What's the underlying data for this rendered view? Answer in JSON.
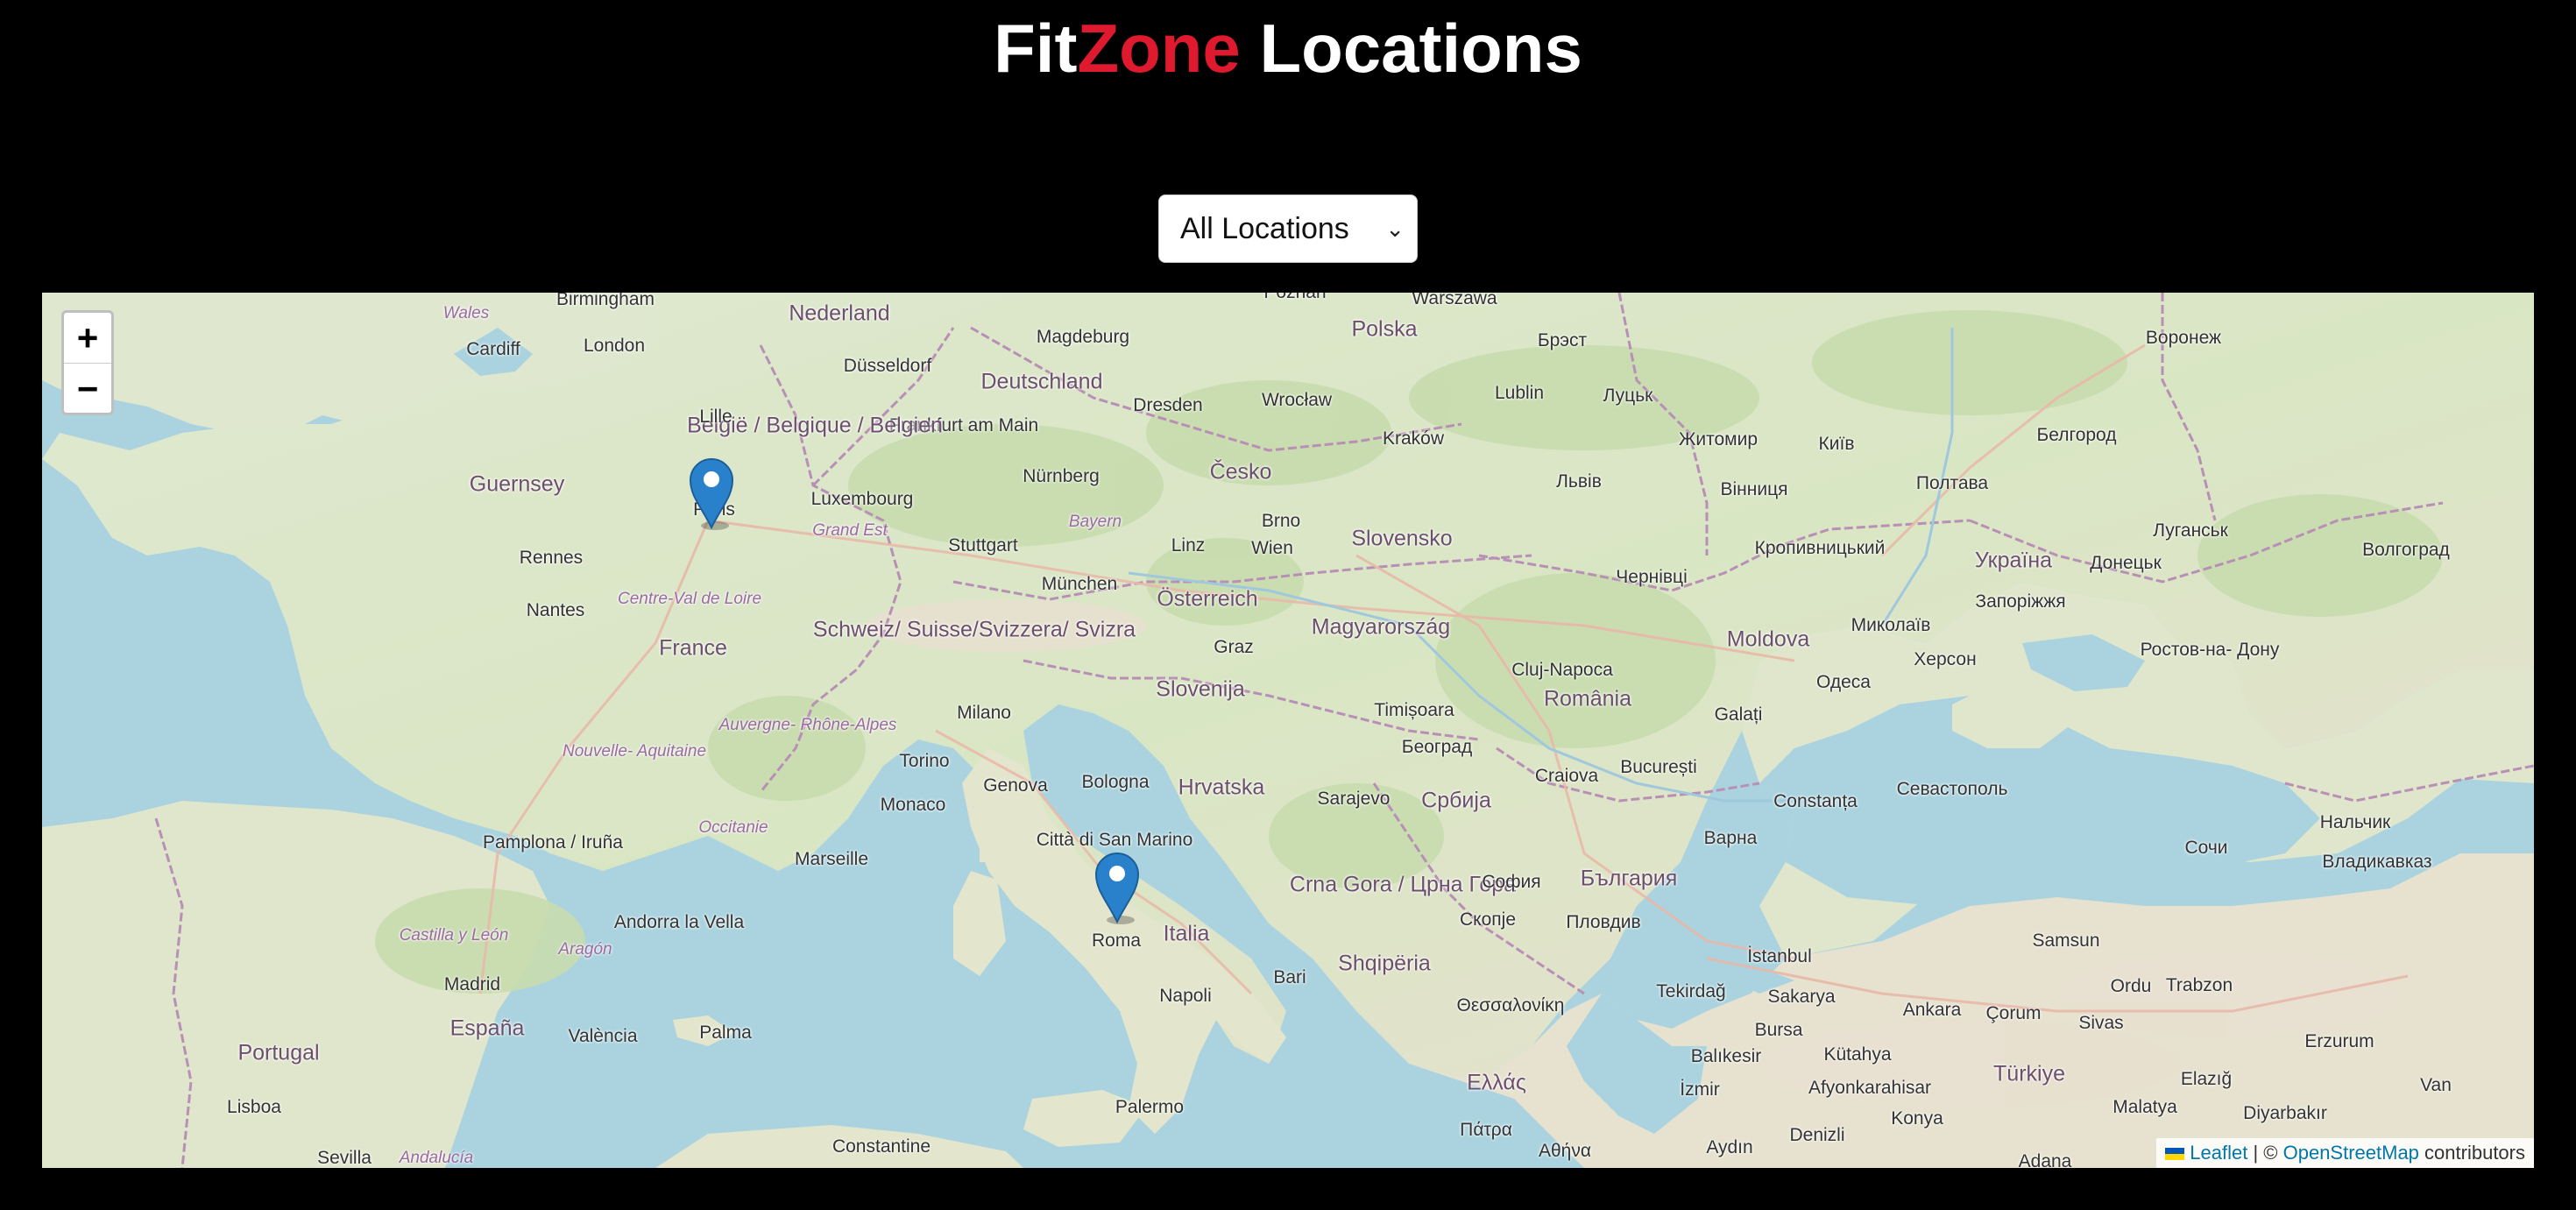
{
  "header": {
    "title_part1": "Fit",
    "title_accent": "Zone",
    "title_part2": " Locations",
    "accent_color": "#e01a2e"
  },
  "filter": {
    "selected": "All Locations",
    "chevron_icon": "chevron-down-icon"
  },
  "map": {
    "zoom_in_label": "+",
    "zoom_out_label": "−",
    "markers": [
      {
        "city": "Paris",
        "icon": "map-pin-icon"
      },
      {
        "city": "Roma",
        "icon": "map-pin-icon"
      }
    ],
    "attribution": {
      "leaflet": "Leaflet",
      "separator": "| ©",
      "osm": "OpenStreetMap",
      "suffix": "contributors"
    },
    "labels": {
      "birmingham": "Birmingham",
      "wales": "Wales",
      "cardiff": "Cardiff",
      "london": "London",
      "nederland": "Nederland",
      "dusseldorf": "Düsseldorf",
      "magdeburg": "Magdeburg",
      "deutschland": "Deutschland",
      "polska": "Polska",
      "warszawa": "Warszawa",
      "dresden": "Dresden",
      "wroclaw": "Wrocław",
      "lublin": "Lublin",
      "frankfurt": "Frankfurt am Main",
      "belgie": "België / Belgique / Belgien",
      "lille": "Lille",
      "guernsey": "Guernsey",
      "luxembourg": "Luxembourg",
      "nurnberg": "Nürnberg",
      "cesko": "Česko",
      "krakow": "Kraków",
      "brno": "Brno",
      "paris": "Paris",
      "rennes": "Rennes",
      "grand_est": "Grand Est",
      "stuttgart": "Stuttgart",
      "bayern": "Bayern",
      "linz": "Linz",
      "wien": "Wien",
      "slovensko": "Slovensko",
      "centre": "Centre-Val de Loire",
      "munchen": "München",
      "osterreich": "Österreich",
      "nantes": "Nantes",
      "schweiz": "Schweiz/ Suisse/Svizzera/ Svizra",
      "magyarorszag": "Magyarország",
      "france": "France",
      "graz": "Graz",
      "slovenija": "Slovenija",
      "cluj": "Cluj-Napoca",
      "romania": "România",
      "auvergne": "Auvergne- Rhône-Alpes",
      "nouvelle": "Nouvelle- Aquitaine",
      "milano": "Milano",
      "timisoara": "Timișoara",
      "torino": "Torino",
      "bologna": "Bologna",
      "hrvatska": "Hrvatska",
      "beograd": "Београд",
      "craiova": "Craiova",
      "bucuresti": "București",
      "galati": "Galați",
      "moldova": "Moldova",
      "odesa": "Одеса",
      "occitanie": "Occitanie",
      "monaco": "Monaco",
      "genova": "Genova",
      "sarajevo": "Sarajevo",
      "srbija": "Србија",
      "constanta": "Constanța",
      "pamplona": "Pamplona / Iruña",
      "marseille": "Marseille",
      "citta": "Città di San Marino",
      "crna_gora": "Crna Gora / Црна Гора",
      "sofia": "София",
      "bulgaria": "България",
      "varna": "Варна",
      "andorra": "Andorra la Vella",
      "castilla": "Castilla y León",
      "aragon": "Aragón",
      "roma": "Roma",
      "italia": "Italia",
      "skopje": "Скопје",
      "plovdiv": "Пловдив",
      "istanbul": "İstanbul",
      "shqiperia": "Shqipëria",
      "bari": "Bari",
      "madrid": "Madrid",
      "espana": "España",
      "valencia": "València",
      "palma": "Palma",
      "napoli": "Napoli",
      "thessaloniki": "Θεσσαλονίκη",
      "tekirdag": "Tekirdağ",
      "sakarya": "Sakarya",
      "ankara": "Ankara",
      "portugal": "Portugal",
      "lisboa": "Lisboa",
      "bursa": "Bursa",
      "ellas": "Ελλάς",
      "palermo": "Palermo",
      "constantine": "Constantine",
      "sevilla": "Sevilla",
      "andalucia": "Andalucía",
      "athina": "Αθήνα",
      "patra": "Πάτρα",
      "izmir": "İzmir",
      "turkiye": "Türkiye",
      "kyiv": "Київ",
      "zhytomyr": "Житомир",
      "lviv": "Львів",
      "vinnytsia": "Вінниця",
      "poltava": "Полтава",
      "ukraina": "Україна",
      "chernivtsi": "Чернівці",
      "kropyvnytskyi": "Кропивницький",
      "mykolaiv": "Миколаїв",
      "zaporizhzhia": "Запоріжжя",
      "kherson": "Херсон",
      "donetsk": "Донецьк",
      "luhansk": "Луганськ",
      "volgograd": "Волгоград",
      "rostov": "Ростов-на- Дону",
      "voronezh": "Воронеж",
      "belgorod": "Белгород",
      "sevastopol": "Севастополь",
      "sochi": "Сочи",
      "samsun": "Samsun",
      "trabzon": "Trabzon",
      "ordu": "Ordu",
      "sivas": "Sivas",
      "corum": "Çorum",
      "kutahya": "Kütahya",
      "afyon": "Afyonkarahisar",
      "konya": "Konya",
      "denizli": "Denizli",
      "erzurum": "Erzurum",
      "elazig": "Elazığ",
      "malatya": "Malatya",
      "diyarbakir": "Diyarbakır",
      "van": "Van",
      "adana": "Adana",
      "aydin": "Aydın",
      "balikesir": "Balıkesir",
      "nalchik": "Нальчик",
      "vladikavkaz": "Владикавказ",
      "brest": "Брэст",
      "lutsk": "Луцьк",
      "poznan": "Poznań"
    }
  }
}
